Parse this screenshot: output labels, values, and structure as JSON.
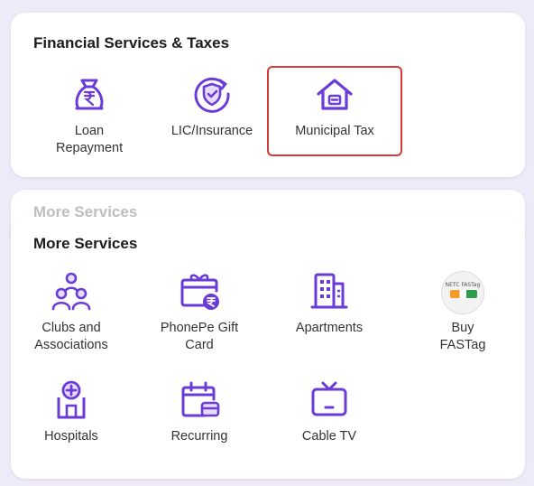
{
  "colors": {
    "accent": "#6a3bd6",
    "highlight": "#d33a3a",
    "background": "#efeaf7"
  },
  "financial": {
    "title": "Financial Services & Taxes",
    "items": [
      {
        "label": "Loan Repayment",
        "icon": "money-bag-rupee-icon"
      },
      {
        "label": "LIC/Insurance",
        "icon": "shield-check-icon"
      },
      {
        "label": "Municipal Tax",
        "icon": "house-icon"
      }
    ]
  },
  "peek": {
    "title": "More Services"
  },
  "more": {
    "title": "More Services",
    "items": [
      {
        "label": "Clubs and Associations",
        "icon": "group-people-icon"
      },
      {
        "label": "PhonePe Gift Card",
        "icon": "gift-card-icon"
      },
      {
        "label": "Apartments",
        "icon": "building-icon"
      },
      {
        "label": "Buy FASTag",
        "icon": "fastag-logo",
        "logo_text": "NETC FASTag"
      },
      {
        "label": "Hospitals",
        "icon": "hospital-icon"
      },
      {
        "label": "Recurring",
        "icon": "calendar-card-icon"
      },
      {
        "label": "Cable TV",
        "icon": "tv-icon"
      }
    ]
  }
}
